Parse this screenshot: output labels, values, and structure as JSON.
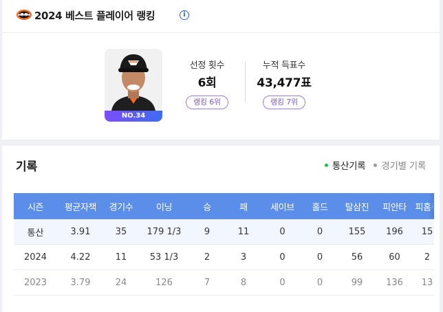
{
  "ranking": {
    "title": "2024 베스트 플레이어 랭킹",
    "info_glyph": "i",
    "player_number": "NO.34",
    "selection": {
      "label": "선정 횟수",
      "value": "6회",
      "rank": "랭킹 6위"
    },
    "votes": {
      "label": "누적 득표수",
      "value": "43,477표",
      "rank": "랭킹 7위"
    },
    "colors": {
      "accent_purple": "#7a55e6",
      "team_orange": "#f26722"
    }
  },
  "record": {
    "title": "기록",
    "tabs": [
      {
        "label": "통산기록",
        "active": true
      },
      {
        "label": "경기별 기록",
        "active": false
      }
    ],
    "table": {
      "columns": [
        "시즌",
        "평균자책",
        "경기수",
        "이닝",
        "승",
        "패",
        "세이브",
        "홀드",
        "탈삼진",
        "피안타",
        "피홈런"
      ],
      "rows": [
        [
          "통산",
          "3.91",
          "35",
          "179 1/3",
          "9",
          "11",
          "0",
          "0",
          "155",
          "196",
          "15"
        ],
        [
          "2024",
          "4.22",
          "11",
          "53 1/3",
          "2",
          "3",
          "0",
          "0",
          "56",
          "60",
          "2"
        ],
        [
          "2023",
          "3.79",
          "24",
          "126",
          "7",
          "8",
          "0",
          "0",
          "99",
          "136",
          "13"
        ]
      ]
    },
    "colors": {
      "header_blue": "#5b8ee8",
      "active_dot": "#1dc14e"
    }
  }
}
